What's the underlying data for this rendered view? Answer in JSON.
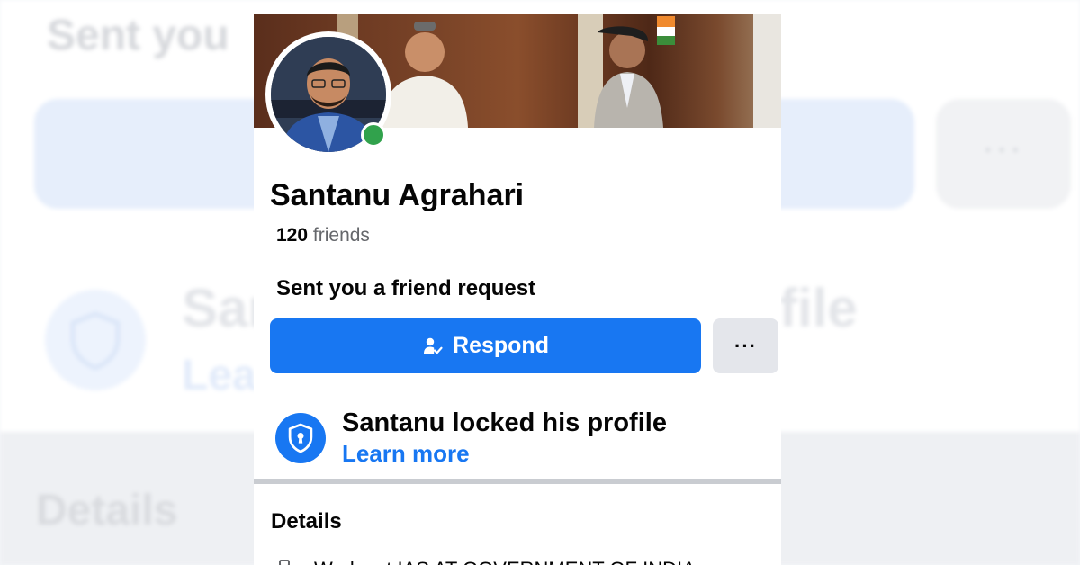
{
  "background": {
    "sent_label": "Sent you",
    "more_label": "···",
    "name_label": "San",
    "name_suffix": "file",
    "learn_label": "Lea",
    "details_label": "Details"
  },
  "profile": {
    "name": "Santanu Agrahari",
    "friends_count": "120",
    "friends_label": "friends",
    "online": true
  },
  "request": {
    "label": "Sent you a friend request",
    "respond_label": "Respond",
    "more_label": "···"
  },
  "locked": {
    "title": "Santanu locked his profile",
    "learn_more": "Learn more"
  },
  "details": {
    "heading": "Details",
    "work": "Works at IAS AT GOVERNMENT OF INDIA"
  },
  "colors": {
    "accent": "#1877f2",
    "online": "#31a24c",
    "secondary_button": "#e4e6eb",
    "muted_text": "#65676b"
  },
  "icons": {
    "respond": "person-check-icon",
    "lock": "shield-keyhole-icon",
    "work": "briefcase-icon",
    "status": "online-dot-icon"
  }
}
